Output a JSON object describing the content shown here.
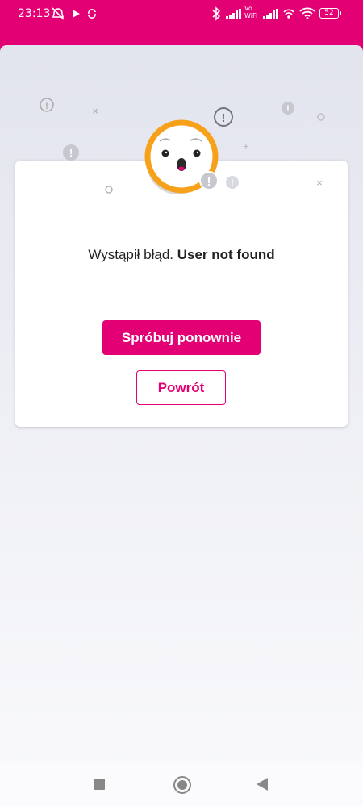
{
  "status_bar": {
    "time": "23:13",
    "vo_wifi_label": "Vo\nWiFi",
    "battery": "52"
  },
  "error": {
    "prefix": "Wystąpił błąd.",
    "message": "User not found"
  },
  "buttons": {
    "retry": "Spróbuj ponownie",
    "back": "Powrót"
  },
  "colors": {
    "brand": "#e20074",
    "face_ring": "#f7a11a"
  },
  "icons": {
    "illustration": "surprised-face-error-icon",
    "nav": [
      "recent-apps-icon",
      "home-icon",
      "back-icon"
    ]
  }
}
